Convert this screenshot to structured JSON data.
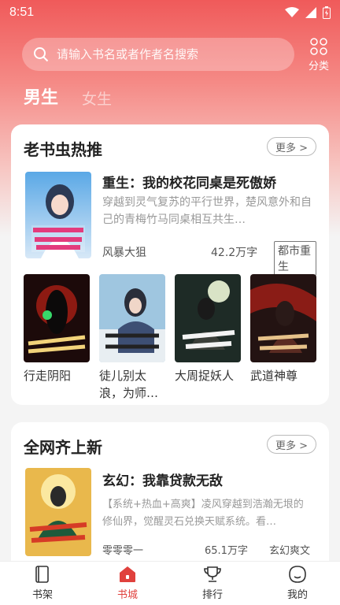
{
  "status_bar": {
    "time": "8:51"
  },
  "search": {
    "placeholder": "请输入书名或者作者名搜索"
  },
  "category_label": "分类",
  "gender_tabs": {
    "male": "男生",
    "female": "女生"
  },
  "section1": {
    "title": "老书虫热推",
    "more_label": "更多 >",
    "featured": {
      "title": "重生：我的校花同桌是死傲娇",
      "description": "穿越到灵气复苏的平行世界，楚风意外和自己的青梅竹马同桌相互共生…",
      "author": "风暴大狙",
      "words": "42.2万字",
      "tag": "都市重生"
    },
    "books": [
      {
        "name": "行走阴阳"
      },
      {
        "name": "徒儿别太浪，为师…"
      },
      {
        "name": "大周捉妖人"
      },
      {
        "name": "武道神尊"
      }
    ]
  },
  "section2": {
    "title": "全网齐上新",
    "more_label": "更多 >",
    "featured": {
      "title": "玄幻：我靠贷款无敌",
      "description": "【系统+热血+高爽】凌风穿越到浩瀚无垠的修仙界，觉醒灵石兑换天赋系统。看…",
      "author": "零零零一",
      "words": "65.1万字",
      "tag": "玄幻爽文"
    }
  },
  "bottom_nav": [
    {
      "label": "书架",
      "icon": "bookshelf-icon"
    },
    {
      "label": "书城",
      "icon": "bookstore-icon"
    },
    {
      "label": "排行",
      "icon": "trophy-icon"
    },
    {
      "label": "我的",
      "icon": "profile-icon"
    }
  ],
  "colors": {
    "accent": "#e0413d",
    "header_gradient_top": "#f05a5a"
  }
}
